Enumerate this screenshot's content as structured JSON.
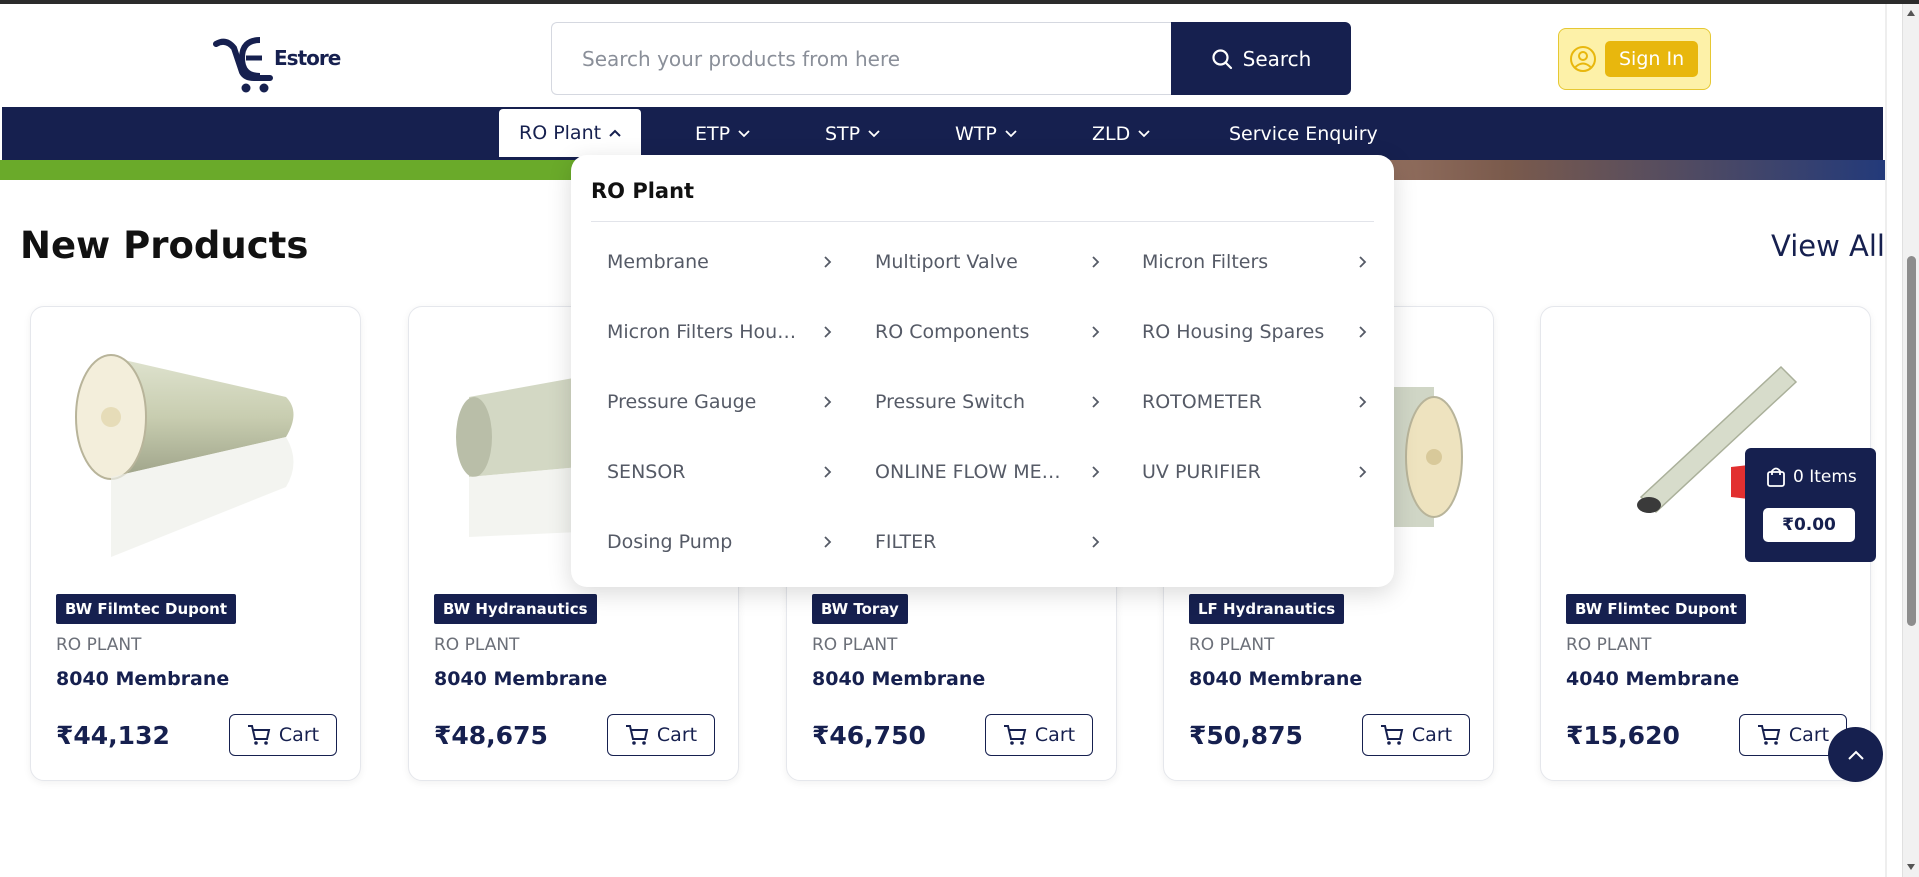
{
  "header": {
    "logo_text": "Estore",
    "search_placeholder": "Search your products from here",
    "search_button": "Search",
    "signin_label": "Sign In"
  },
  "nav": {
    "items": [
      {
        "label": "RO Plant"
      },
      {
        "label": "ETP"
      },
      {
        "label": "STP"
      },
      {
        "label": "WTP"
      },
      {
        "label": "ZLD"
      },
      {
        "label": "Service Enquiry"
      }
    ]
  },
  "dropdown": {
    "title": "RO Plant",
    "items": [
      {
        "label": "Membrane"
      },
      {
        "label": "Multiport Valve"
      },
      {
        "label": "Micron Filters"
      },
      {
        "label": "Micron Filters Housi..."
      },
      {
        "label": "RO Components"
      },
      {
        "label": "RO Housing Spares"
      },
      {
        "label": "Pressure Gauge"
      },
      {
        "label": "Pressure Switch"
      },
      {
        "label": "ROTOMETER"
      },
      {
        "label": "SENSOR"
      },
      {
        "label": "ONLINE FLOW METER"
      },
      {
        "label": "UV PURIFIER"
      },
      {
        "label": "Dosing Pump"
      },
      {
        "label": "FILTER"
      }
    ]
  },
  "section": {
    "title": "New Products",
    "view_all": "View All"
  },
  "products": [
    {
      "brand": "BW Filmtec Dupont",
      "category": "RO PLANT",
      "name": "8040 Membrane",
      "price": "₹44,132",
      "cart_label": "Cart"
    },
    {
      "brand": "BW Hydranautics",
      "category": "RO PLANT",
      "name": "8040 Membrane",
      "price": "₹48,675",
      "cart_label": "Cart"
    },
    {
      "brand": "BW Toray",
      "category": "RO PLANT",
      "name": "8040 Membrane",
      "price": "₹46,750",
      "cart_label": "Cart"
    },
    {
      "brand": "LF Hydranautics",
      "category": "RO PLANT",
      "name": "8040 Membrane",
      "price": "₹50,875",
      "cart_label": "Cart"
    },
    {
      "brand": "BW Flimtec Dupont",
      "category": "RO PLANT",
      "name": "4040 Membrane",
      "price": "₹15,620",
      "cart_label": "Cart"
    }
  ],
  "mini_cart": {
    "items_label": "0 Items",
    "total": "₹0.00"
  },
  "colors": {
    "primary": "#16204f",
    "accent_yellow": "#e8b70d",
    "signin_bg": "#fdf1a8",
    "banner_green": "#6aaa2a"
  },
  "icons": [
    "cart-logo-icon",
    "search-icon",
    "user-icon",
    "chevron-up-icon",
    "chevron-down-icon",
    "chevron-right-icon",
    "cart-icon",
    "shopping-bag-icon",
    "arrow-up-icon"
  ]
}
